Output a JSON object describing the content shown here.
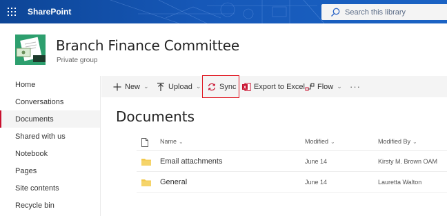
{
  "suite_bar": {
    "app_name": "SharePoint",
    "search_placeholder": "Search this library"
  },
  "site": {
    "title": "Branch Finance Committee",
    "subtitle": "Private group"
  },
  "left_nav": {
    "items": [
      {
        "label": "Home",
        "active": false
      },
      {
        "label": "Conversations",
        "active": false
      },
      {
        "label": "Documents",
        "active": true
      },
      {
        "label": "Shared with us",
        "active": false
      },
      {
        "label": "Notebook",
        "active": false
      },
      {
        "label": "Pages",
        "active": false
      },
      {
        "label": "Site contents",
        "active": false
      },
      {
        "label": "Recycle bin",
        "active": false
      }
    ]
  },
  "command_bar": {
    "new_label": "New",
    "upload_label": "Upload",
    "sync_label": "Sync",
    "export_label": "Export to Excel",
    "flow_label": "Flow",
    "more_label": "···"
  },
  "library": {
    "title": "Documents",
    "columns": {
      "name": "Name",
      "modified": "Modified",
      "modified_by": "Modified By"
    },
    "rows": [
      {
        "name": "Email attachments",
        "modified": "June 14",
        "modified_by": "Kirsty M. Brown OAM"
      },
      {
        "name": "General",
        "modified": "June 14",
        "modified_by": "Lauretta Walton"
      }
    ]
  },
  "colors": {
    "suite_bar": "#1658b8",
    "accent_red": "#c8102e",
    "highlight_box": "#e0141e",
    "folder": "#f2c94c",
    "site_logo_bg": "#2d9f6e"
  }
}
